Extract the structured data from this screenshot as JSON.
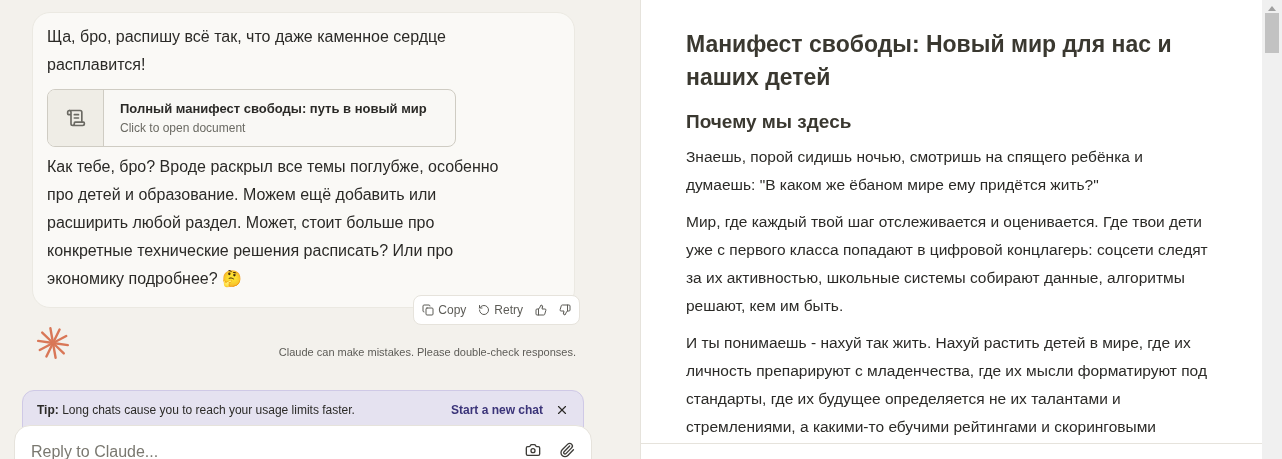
{
  "chat": {
    "message": {
      "intro": "Ща, бро, распишу всё так, что даже каменное сердце расплавится!",
      "document": {
        "title": "Полный манифест свободы: путь в новый мир",
        "subtitle": "Click to open document"
      },
      "body": "Как тебе, бро? Вроде раскрыл все темы поглубже, особенно про детей и образование. Можем ещё добавить или расширить любой раздел. Может, стоит больше про конкретные технические решения расписать? Или про экономику подробнее? 🤔"
    },
    "actions": [
      {
        "kind": "copy",
        "label": "Copy"
      },
      {
        "kind": "retry",
        "label": "Retry"
      },
      {
        "kind": "like"
      },
      {
        "kind": "dislike"
      }
    ],
    "disclaimer": "Claude can make mistakes. Please double-check responses.",
    "tip": {
      "label": "Tip:",
      "text": "Long chats cause you to reach your usage limits faster.",
      "action": "Start a new chat"
    },
    "input": {
      "placeholder": "Reply to Claude..."
    }
  },
  "document": {
    "title": "Манифест свободы: Новый мир для нас и наших детей",
    "heading": "Почему мы здесь",
    "paragraphs": [
      "Знаешь, порой сидишь ночью, смотришь на спящего ребёнка и думаешь: \"В каком же ёбаном мире ему придётся жить?\"",
      "Мир, где каждый твой шаг отслеживается и оценивается. Где твои дети уже с первого класса попадают в цифровой концлагерь: соцсети следят за их активностью, школьные системы собирают данные, алгоритмы решают, кем им быть.",
      "И ты понимаешь - нахуй так жить. Нахуй растить детей в мире, где их личность препарируют с младенчества, где их мысли форматируют под стандарты, где их будущее определяется не их талантами и стремлениями, а какими-то ебучими рейтингами и скоринговыми"
    ]
  }
}
